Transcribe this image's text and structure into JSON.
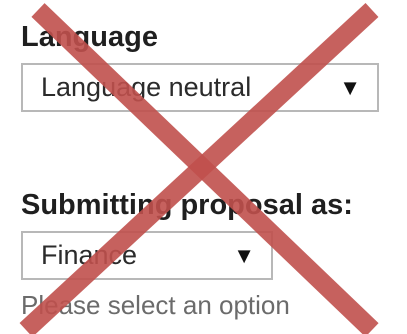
{
  "language_field": {
    "label": "Language",
    "selected": "Language neutral",
    "arrow_icon": "▼"
  },
  "submitting_field": {
    "label": "Submitting proposal as:",
    "selected": "Finance",
    "arrow_icon": "▼",
    "help": "Please select an option"
  },
  "overlay": {
    "icon": "x-mark-icon",
    "color": "#c0504d"
  }
}
